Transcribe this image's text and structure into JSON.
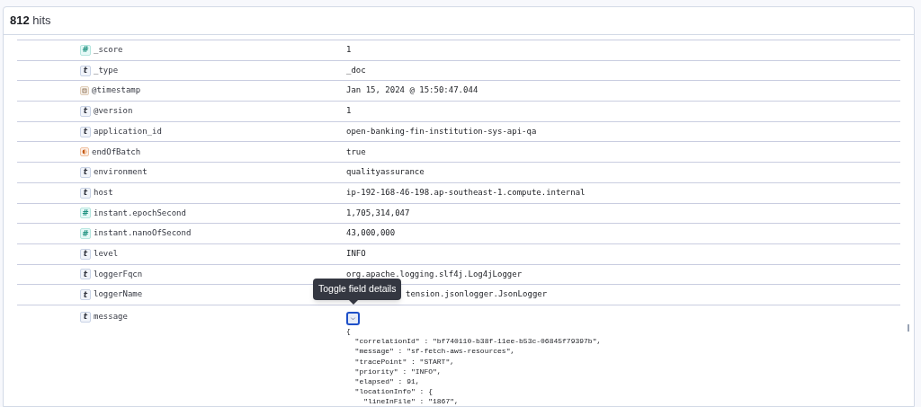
{
  "header": {
    "count": "812",
    "label": "hits"
  },
  "fields": [
    {
      "kind": "number",
      "glyph": "#",
      "name": "_score",
      "value": "1"
    },
    {
      "kind": "string",
      "glyph": "t",
      "name": "_type",
      "value": "_doc"
    },
    {
      "kind": "date",
      "name": "@timestamp",
      "value": "Jan 15, 2024 @ 15:50:47.044"
    },
    {
      "kind": "string",
      "glyph": "t",
      "name": "@version",
      "value": "1"
    },
    {
      "kind": "string",
      "glyph": "t",
      "name": "application_id",
      "value": "open-banking-fin-institution-sys-api-qa"
    },
    {
      "kind": "boolean",
      "name": "endOfBatch",
      "value": "true"
    },
    {
      "kind": "string",
      "glyph": "t",
      "name": "environment",
      "value": "qualityassurance"
    },
    {
      "kind": "string",
      "glyph": "t",
      "name": "host",
      "value": "ip-192-168-46-198.ap-southeast-1.compute.internal"
    },
    {
      "kind": "number",
      "glyph": "#",
      "name": "instant.epochSecond",
      "value": "1,705,314,047"
    },
    {
      "kind": "number",
      "glyph": "#",
      "name": "instant.nanoOfSecond",
      "value": "43,000,000"
    },
    {
      "kind": "string",
      "glyph": "t",
      "name": "level",
      "value": "INFO"
    },
    {
      "kind": "string",
      "glyph": "t",
      "name": "loggerFqcn",
      "value": "org.apache.logging.slf4j.Log4jLogger"
    },
    {
      "kind": "string",
      "glyph": "t",
      "name": "loggerName",
      "value": "tension.jsonlogger.JsonLogger",
      "partly_hidden": true
    }
  ],
  "message_field": {
    "kind": "string",
    "glyph": "t",
    "name": "message",
    "expanded": true,
    "tooltip": "Toggle field details",
    "lines": [
      "{",
      "  \"correlationId\" : \"bf740110-b38f-11ee-b53c-06845f79397b\",",
      "  \"message\" : \"sf-fetch-aws-resources\",",
      "  \"tracePoint\" : \"START\",",
      "  \"priority\" : \"INFO\",",
      "  \"elapsed\" : 91,",
      "  \"locationInfo\" : {",
      "    \"lineInFile\" : \"1867\","
    ]
  }
}
